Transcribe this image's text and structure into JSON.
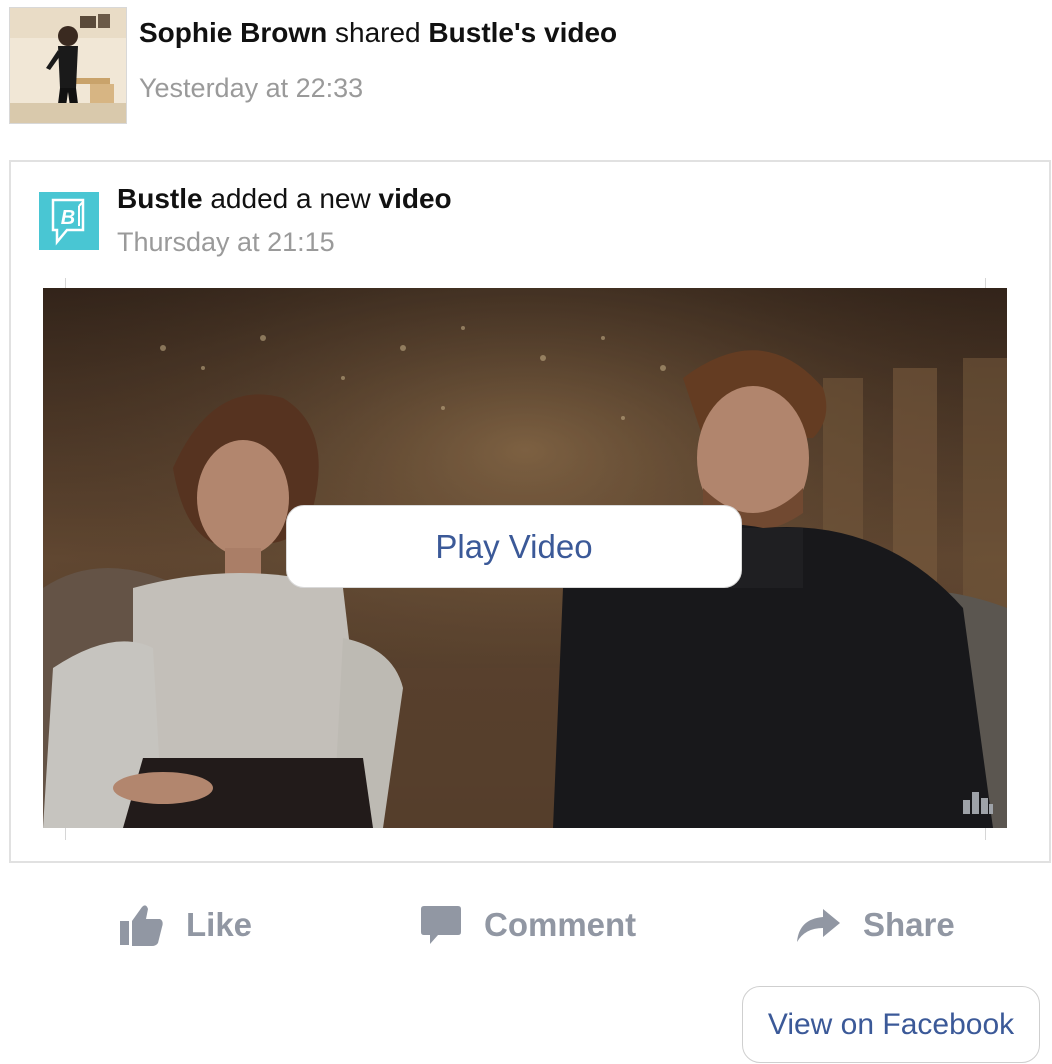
{
  "post": {
    "author": "Sophie Brown",
    "verb": "shared",
    "page_possessive": "Bustle's",
    "object": "video",
    "timestamp": "Yesterday at 22:33"
  },
  "shared_card": {
    "page_name": "Bustle",
    "action_text": "added a new",
    "object": "video",
    "timestamp": "Thursday at 21:15",
    "logo_letter": "B"
  },
  "video": {
    "play_label": "Play Video"
  },
  "actions": {
    "like": "Like",
    "comment": "Comment",
    "share": "Share"
  },
  "view_on_facebook": "View on Facebook",
  "colors": {
    "facebook_blue": "#3b5998",
    "action_gray": "#9197a3",
    "timestamp_gray": "#9a9a9a",
    "bustle_teal": "#49c6d3"
  },
  "icons": [
    "thumbs-up-icon",
    "comment-bubble-icon",
    "share-arrow-icon",
    "bar-chart-icon"
  ]
}
